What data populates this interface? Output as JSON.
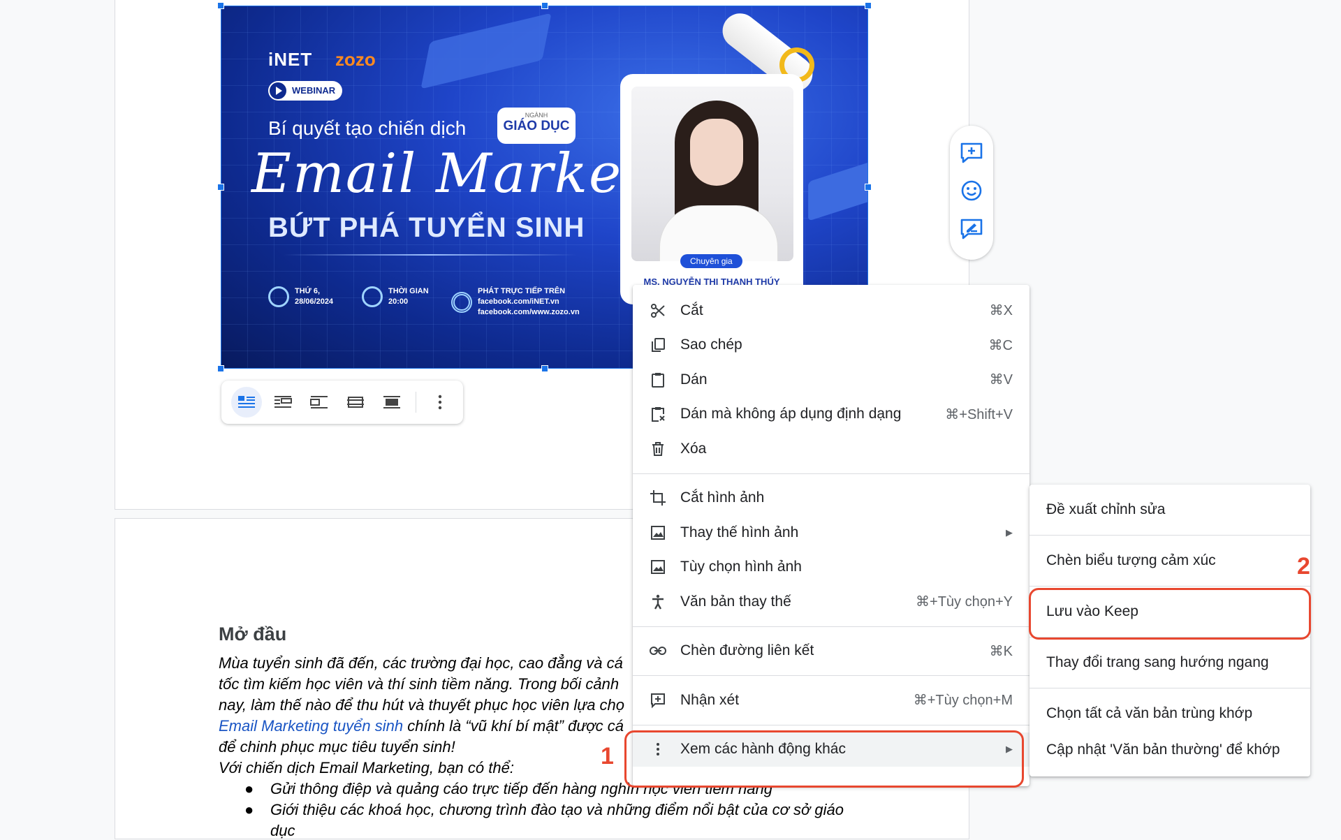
{
  "banner": {
    "logo_inet": "iNET",
    "logo_zozo": "zozo",
    "badge": "WEBINAR",
    "subtitle": "Bí quyết tạo chiến dịch",
    "field_small": "NGÀNH",
    "field_big": "GIÁO DỤC",
    "script_title": "Email Marketing",
    "headline": "BỨT PHÁ TUYỂN SINH",
    "info1": [
      "THỨ 6,",
      "28/06/2024"
    ],
    "info2": [
      "THỜI GIAN",
      "20:00"
    ],
    "info3": [
      "PHÁT TRỰC TIẾP TRÊN",
      "facebook.com/iNET.vn",
      "facebook.com/www.zozo.vn"
    ],
    "expert_label": "Chuyên gia",
    "expert_name": "MS. NGUYỄN THỊ THANH THÚY"
  },
  "image_toolbar": {
    "buttons": [
      "inline-icon",
      "wrap-text-icon",
      "break-text-icon",
      "behind-text-icon",
      "in-front-of-text-icon",
      "more-vert-icon"
    ],
    "active_index": 0
  },
  "side_toolbar": [
    "add-comment-icon",
    "emoji-icon",
    "suggest-edit-icon"
  ],
  "document": {
    "heading": "Mở đầu",
    "lines": [
      "Mùa tuyển sinh đã đến, các trường đại học, cao đẳng và cá",
      "tốc tìm kiếm học viên và thí sinh tiềm năng. Trong bối cảnh",
      "nay, làm thế nào để thu hút và thuyết phục học viên lựa chọ"
    ],
    "link_text": "Email Marketing tuyển sinh",
    "line4_rest": " chính là “vũ khí bí mật” được cá",
    "line5": "để chinh phục mục tiêu tuyển sinh!",
    "line6": "Với chiến dịch Email Marketing, bạn có thể:",
    "bullets": [
      "Gửi thông điệp và quảng cáo trực tiếp đến hàng nghìn học viên tiềm năng",
      "Giới thiệu các khoá học, chương trình đào tạo và những điểm nổi bật của cơ sở giáo",
      "dục"
    ]
  },
  "context_menu": {
    "items": [
      {
        "icon": "scissors-icon",
        "label": "Cắt",
        "shortcut": "⌘X"
      },
      {
        "icon": "copy-icon",
        "label": "Sao chép",
        "shortcut": "⌘C"
      },
      {
        "icon": "paste-icon",
        "label": "Dán",
        "shortcut": "⌘V"
      },
      {
        "icon": "paste-plain-icon",
        "label": "Dán mà không áp dụng định dạng",
        "shortcut": "⌘+Shift+V"
      },
      {
        "icon": "trash-icon",
        "label": "Xóa",
        "shortcut": ""
      },
      {
        "icon": "crop-icon",
        "label": "Cắt hình ảnh",
        "shortcut": ""
      },
      {
        "icon": "image-icon",
        "label": "Thay thế hình ảnh",
        "shortcut": ""
      },
      {
        "icon": "image-icon",
        "label": "Tùy chọn hình ảnh",
        "shortcut": ""
      },
      {
        "icon": "accessibility-icon",
        "label": "Văn bản thay thế",
        "shortcut": "⌘+Tùy chọn+Y"
      },
      {
        "icon": "link-icon",
        "label": "Chèn đường liên kết",
        "shortcut": "⌘K"
      },
      {
        "icon": "add-comment-icon",
        "label": "Nhận xét",
        "shortcut": "⌘+Tùy chọn+M"
      },
      {
        "icon": "more-vert-icon",
        "label": "Xem các hành động khác",
        "shortcut": ""
      }
    ]
  },
  "submenu": {
    "items": [
      "Đề xuất chỉnh sửa",
      "Chèn biểu tượng cảm xúc",
      "Lưu vào Keep",
      "Thay đổi trang sang hướng ngang",
      "Chọn tất cả văn bản trùng khớp",
      "Cập nhật 'Văn bản thường' để khớp"
    ]
  },
  "annotations": {
    "step1": "1",
    "step2": "2",
    "color": "#e8472f"
  }
}
